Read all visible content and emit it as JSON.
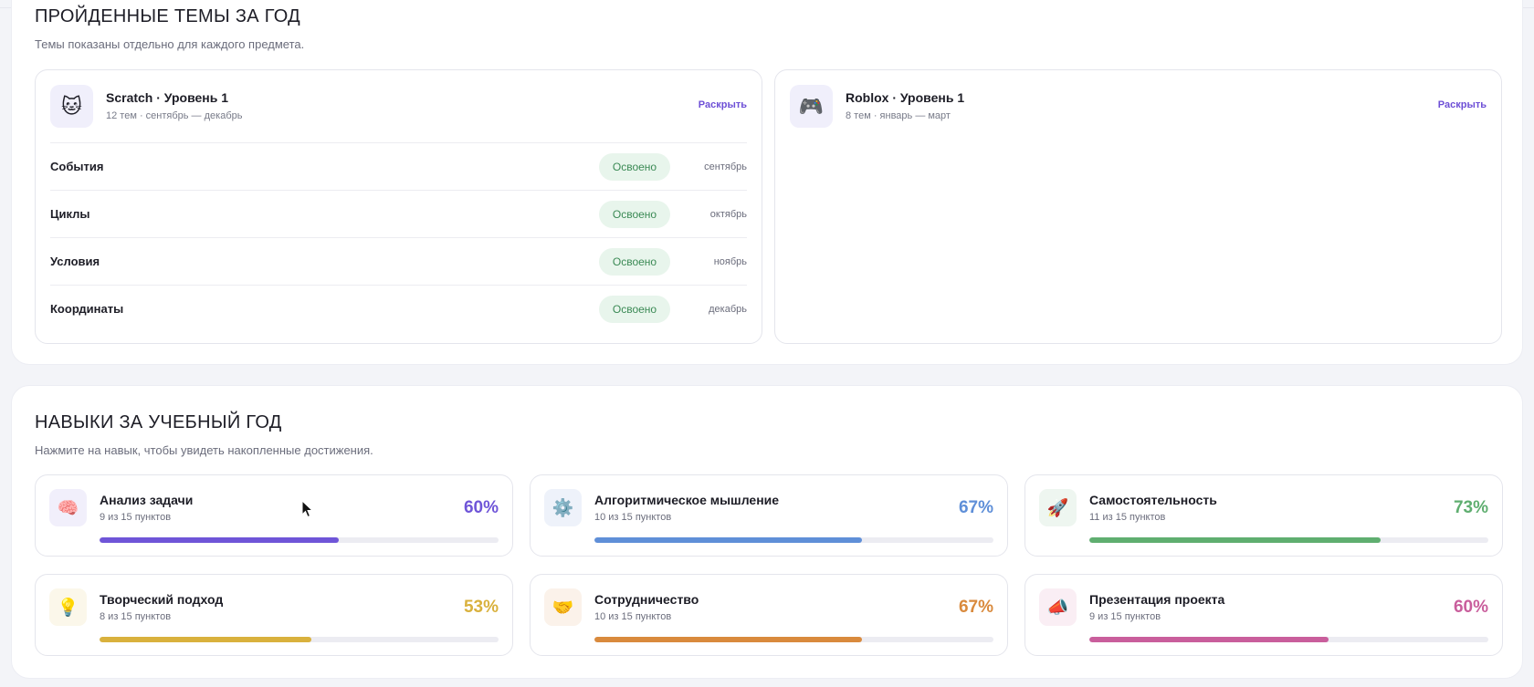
{
  "topics": {
    "title": "ПРОЙДЕННЫЕ ТЕМЫ ЗА ГОД",
    "subtitle": "Темы показаны отдельно для каждого предмета.",
    "courses": [
      {
        "icon": "cat-face-icon",
        "title": "Scratch · Уровень 1",
        "meta": "12 тем · сентябрь — декабрь",
        "expand_label": "Раскрыть",
        "rows": [
          {
            "name": "События",
            "status": "Освоено",
            "month": "сентябрь"
          },
          {
            "name": "Циклы",
            "status": "Освоено",
            "month": "октябрь"
          },
          {
            "name": "Условия",
            "status": "Освоено",
            "month": "ноябрь"
          },
          {
            "name": "Координаты",
            "status": "Освоено",
            "month": "декабрь"
          }
        ]
      },
      {
        "icon": "gamepad-icon",
        "title": "Roblox · Уровень 1",
        "meta": "8 тем · январь — март",
        "expand_label": "Раскрыть",
        "rows": []
      }
    ]
  },
  "skills": {
    "title": "НАВЫКИ ЗА УЧЕБНЫЙ ГОД",
    "subtitle": "Нажмите на навык, чтобы увидеть накопленные достижения.",
    "items": [
      {
        "icon": "brain-icon",
        "title": "Анализ задачи",
        "sub": "9 из 15 пунктов",
        "pct_label": "60%",
        "progress": 0.6,
        "color": "#6f55d8",
        "icon_bg": "#f1effb"
      },
      {
        "icon": "gear-icon",
        "title": "Алгоритмическое мышление",
        "sub": "10 из 15 пунктов",
        "pct_label": "67%",
        "progress": 0.67,
        "color": "#5f8fd8",
        "icon_bg": "#eef2fa"
      },
      {
        "icon": "rocket-icon",
        "title": "Самостоятельность",
        "sub": "11 из 15 пунктов",
        "pct_label": "73%",
        "progress": 0.73,
        "color": "#5fae70",
        "icon_bg": "#eef6f0"
      },
      {
        "icon": "light-bulb-icon",
        "title": "Творческий подход",
        "sub": "8 из 15 пунктов",
        "pct_label": "53%",
        "progress": 0.53,
        "color": "#d9b13d",
        "icon_bg": "#fbf7ea"
      },
      {
        "icon": "handshake-icon",
        "title": "Сотрудничество",
        "sub": "10 из 15 пунктов",
        "pct_label": "67%",
        "progress": 0.67,
        "color": "#d98a3d",
        "icon_bg": "#fbf2ea"
      },
      {
        "icon": "megaphone-icon",
        "title": "Презентация проекта",
        "sub": "9 из 15 пунктов",
        "pct_label": "60%",
        "progress": 0.6,
        "color": "#c95e9c",
        "icon_bg": "#faeef4"
      }
    ]
  }
}
